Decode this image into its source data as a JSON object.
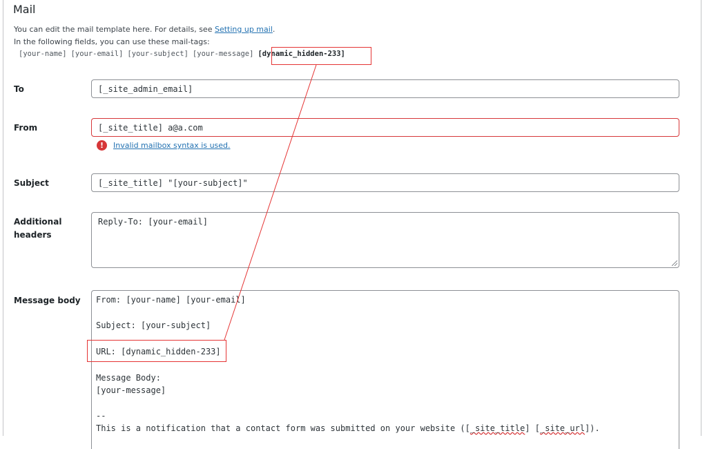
{
  "panel": {
    "title": "Mail",
    "description_prefix": "You can edit the mail template here. For details, see ",
    "description_link": "Setting up mail",
    "description_suffix": ".",
    "mailtags_intro": "In the following fields, you can use these mail-tags:",
    "mailtags": [
      "[your-name]",
      "[your-email]",
      "[your-subject]",
      "[your-message]"
    ],
    "highlighted_tag": "[dynamic_hidden-233]"
  },
  "fields": {
    "to": {
      "label": "To",
      "value": "[_site_admin_email]"
    },
    "from": {
      "label": "From",
      "value": "[_site_title] a@a.com",
      "error": "Invalid mailbox syntax is used."
    },
    "subject": {
      "label": "Subject",
      "value": "[_site_title] \"[your-subject]\""
    },
    "additional_headers": {
      "label_line1": "Additional",
      "label_line2": "headers",
      "value": "Reply-To: [your-email]"
    },
    "message_body": {
      "label": "Message body",
      "line1": "From: [your-name] [your-email]",
      "line2": "Subject: [your-subject]",
      "line3": "URL: [dynamic_hidden-233]",
      "line4": "Message Body:",
      "line5": "[your-message]",
      "line6": "--",
      "line7_prefix": "This is a notification that a contact form was submitted on your website ([",
      "line7_word1": "_site_title",
      "line7_middle": "] [",
      "line7_word2": "_site_url",
      "line7_suffix": "])."
    }
  },
  "annotation": {
    "color": "#e53333"
  }
}
